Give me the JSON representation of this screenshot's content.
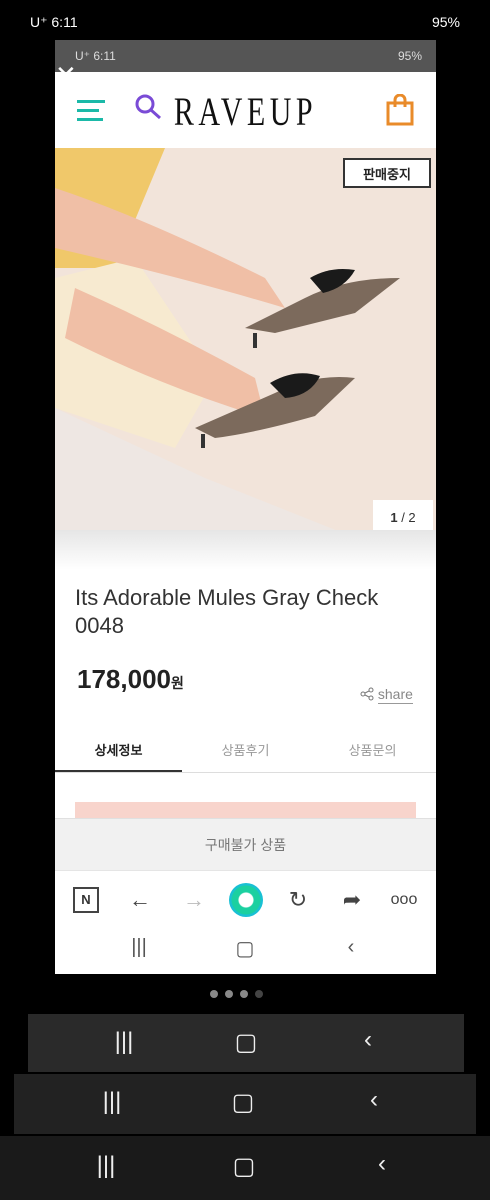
{
  "outer_status": {
    "left": "U⁺ 6:11",
    "right": "95%"
  },
  "inner_status": {
    "left": "U⁺ 6:11",
    "right": "95%"
  },
  "header": {
    "logo": "RAVEUP"
  },
  "product": {
    "stop_badge": "판매중지",
    "image_counter_current": "1",
    "image_counter_total": "/ 2",
    "title": "Its Adorable Mules Gray Check 0048",
    "price": "178,000",
    "price_unit": "원",
    "share_label": "share"
  },
  "tabs": [
    {
      "label": "상세정보",
      "active": true
    },
    {
      "label": "상품후기",
      "active": false
    },
    {
      "label": "상품문의",
      "active": false
    }
  ],
  "purchase_bar": {
    "label": "구매불가 상품"
  },
  "browser_bar": {
    "icons": [
      "naver-n-icon",
      "back-arrow-icon",
      "forward-arrow-icon",
      "naver-green-dot-icon",
      "refresh-icon",
      "share-arrow-icon",
      "more-dots-icon"
    ],
    "n_label": "N"
  },
  "colors": {
    "accent_teal": "#1bb9a8",
    "cart_orange": "#e98b2a",
    "search_purple": "#7a4bd6"
  }
}
